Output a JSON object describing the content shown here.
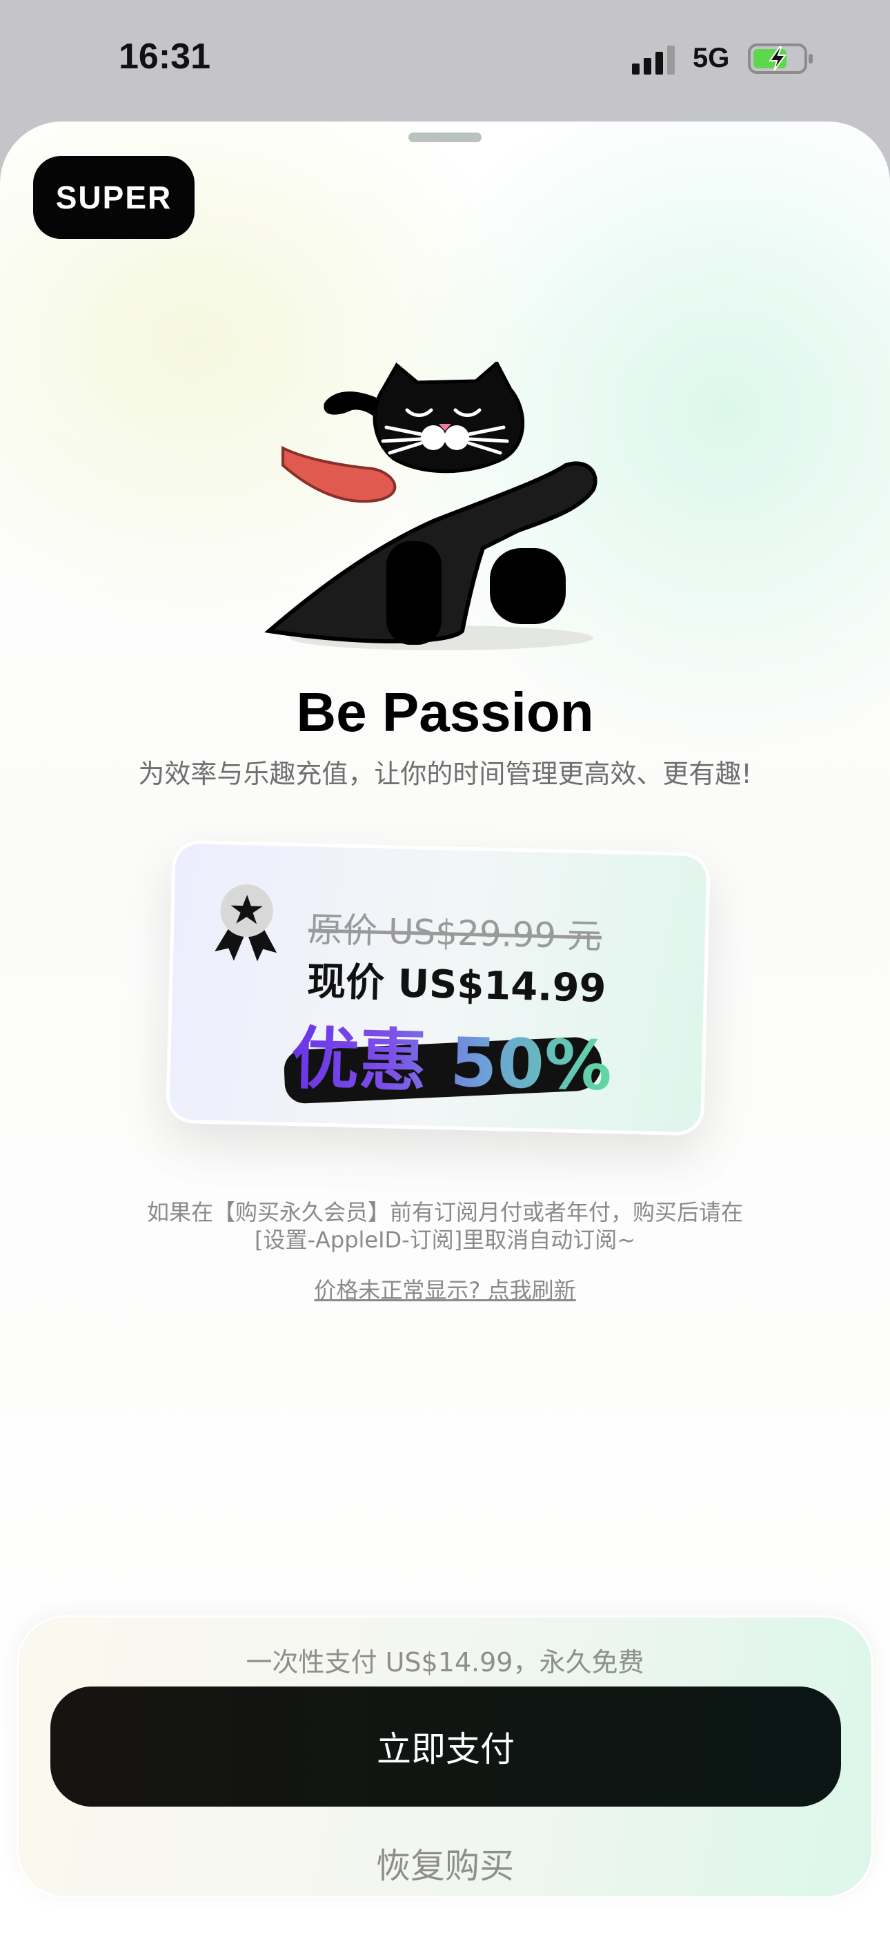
{
  "status_bar": {
    "time": "16:31",
    "network": "5G",
    "icons": [
      "signal-icon",
      "battery-charging-icon"
    ]
  },
  "badge": {
    "label": "SUPER"
  },
  "hero": {
    "title": "Be Passion",
    "subtitle": "为效率与乐趣充值，让你的时间管理更高效、更有趣!"
  },
  "price_card": {
    "original_price": "原价 US$29.99 元",
    "current_price": "现价 US$14.99",
    "discount": "优惠 50%",
    "icon": "medal-icon"
  },
  "notice": {
    "line1": "如果在【购买永久会员】前有订阅月付或者年付，购买后请在",
    "line2": "[设置-AppleID-订阅]里取消自动订阅~",
    "refresh_link": "价格未正常显示? 点我刷新"
  },
  "checkout": {
    "summary": "一次性支付 US$14.99，永久免费",
    "pay_button": "立即支付",
    "restore_button": "恢复购买"
  },
  "colors": {
    "accent_purple": "#6a35e8",
    "accent_green": "#5fd9a0",
    "button_dark": "#111111",
    "battery_green": "#5dd84c"
  }
}
